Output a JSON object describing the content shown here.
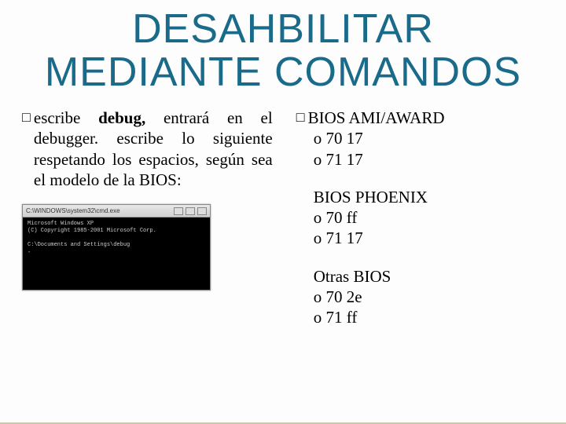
{
  "title": "DESAHBILITAR MEDIANTE COMANDOS",
  "left": {
    "bullet": "□",
    "text_pre": "escribe ",
    "text_bold": "debug,",
    "text_post": " entrará en el debugger. escribe lo siguiente respetando los espacios, según sea el modelo de la BIOS:"
  },
  "right": {
    "bullet": "□",
    "bios1_title": "BIOS AMI/AWARD",
    "bios1_l1": "o 70 17",
    "bios1_l2": "o 71 17",
    "bios2_title": "BIOS PHOENIX",
    "bios2_l1": "o 70 ff",
    "bios2_l2": "o 71 17",
    "bios3_title": "Otras BIOS",
    "bios3_l1": "o 70 2e",
    "bios3_l2": "o 71 ff"
  },
  "terminal": {
    "title": "C:\\WINDOWS\\system32\\cmd.exe",
    "body": "Microsoft Windows XP\n(C) Copyright 1985-2001 Microsoft Corp.\n\nC:\\Documents and Settings\\debug\n-"
  }
}
